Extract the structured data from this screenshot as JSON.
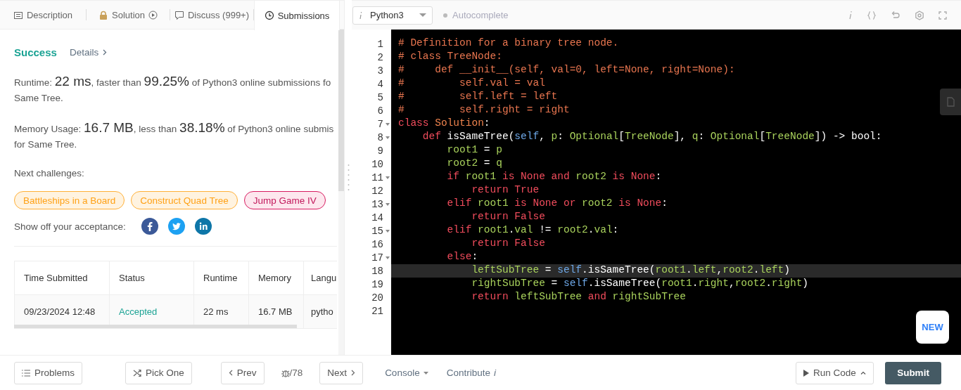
{
  "tabs": [
    {
      "label": "Description",
      "selected": false
    },
    {
      "label": "Solution",
      "selected": false
    },
    {
      "label": "Discuss (999+)",
      "selected": false
    },
    {
      "label": "Submissions",
      "selected": true
    }
  ],
  "result": {
    "status": "Success",
    "details_link": "Details",
    "runtime": {
      "segments": [
        {
          "text": "Runtime: ",
          "kind": "label"
        },
        {
          "text": "22 ms",
          "kind": "value"
        },
        {
          "text": ", faster than ",
          "kind": "label"
        },
        {
          "text": "99.25%",
          "kind": "value"
        },
        {
          "text": " of Python3 online submissions fo",
          "kind": "label"
        }
      ],
      "second_line": "Same Tree."
    },
    "memory": {
      "segments": [
        {
          "text": "Memory Usage: ",
          "kind": "label"
        },
        {
          "text": "16.7 MB",
          "kind": "value"
        },
        {
          "text": ", less than ",
          "kind": "label"
        },
        {
          "text": "38.18%",
          "kind": "value"
        },
        {
          "text": " of Python3 online submis",
          "kind": "label"
        }
      ],
      "second_line": "for Same Tree."
    },
    "next_label": "Next challenges:",
    "challenges": [
      {
        "label": "Battleships in a Board",
        "kind": "medium"
      },
      {
        "label": "Construct Quad Tree",
        "kind": "medium"
      },
      {
        "label": "Jump Game IV",
        "kind": "hard"
      }
    ],
    "share_label": "Show off your acceptance:"
  },
  "table": {
    "columns": [
      "Time Submitted",
      "Status",
      "Runtime",
      "Memory",
      "Langu"
    ],
    "rows": [
      {
        "cells": [
          "09/23/2024 12:48",
          "Accepted",
          "22 ms",
          "16.7 MB",
          "pytho"
        ],
        "kind": "accepted"
      }
    ]
  },
  "editor": {
    "language": "Python3",
    "autocomplete": "Autocomplete",
    "new_badge": "NEW",
    "lines": [
      {
        "number": "1",
        "fold": false,
        "active": false,
        "tokens": [
          {
            "kind": "comment",
            "text": "# Definition for a binary tree node."
          }
        ]
      },
      {
        "number": "2",
        "fold": false,
        "active": false,
        "tokens": [
          {
            "kind": "comment",
            "text": "# class TreeNode:"
          }
        ]
      },
      {
        "number": "3",
        "fold": false,
        "active": false,
        "tokens": [
          {
            "kind": "comment",
            "text": "#     def __init__(self, val=0, left=None, right=None):"
          }
        ]
      },
      {
        "number": "4",
        "fold": false,
        "active": false,
        "tokens": [
          {
            "kind": "comment",
            "text": "#         self.val = val"
          }
        ]
      },
      {
        "number": "5",
        "fold": false,
        "active": false,
        "tokens": [
          {
            "kind": "comment",
            "text": "#         self.left = left"
          }
        ]
      },
      {
        "number": "6",
        "fold": false,
        "active": false,
        "tokens": [
          {
            "kind": "comment",
            "text": "#         self.right = right"
          }
        ]
      },
      {
        "number": "7",
        "fold": true,
        "active": false,
        "tokens": [
          {
            "kind": "keyword",
            "text": "class"
          },
          {
            "kind": "class",
            "text": " Solution"
          },
          {
            "kind": "plain",
            "text": ":"
          }
        ]
      },
      {
        "number": "8",
        "fold": true,
        "active": false,
        "tokens": [
          {
            "kind": "keyword",
            "text": "    def"
          },
          {
            "kind": "plain",
            "text": " isSameTree("
          },
          {
            "kind": "self",
            "text": "self"
          },
          {
            "kind": "plain",
            "text": ","
          },
          {
            "kind": "name",
            "text": " p"
          },
          {
            "kind": "plain",
            "text": ":"
          },
          {
            "kind": "name",
            "text": " Optional"
          },
          {
            "kind": "plain",
            "text": "["
          },
          {
            "kind": "name",
            "text": "TreeNode"
          },
          {
            "kind": "plain",
            "text": "],"
          },
          {
            "kind": "name",
            "text": " q"
          },
          {
            "kind": "plain",
            "text": ":"
          },
          {
            "kind": "name",
            "text": " Optional"
          },
          {
            "kind": "plain",
            "text": "["
          },
          {
            "kind": "name",
            "text": "TreeNode"
          },
          {
            "kind": "plain",
            "text": "]) -> bool:"
          }
        ]
      },
      {
        "number": "9",
        "fold": false,
        "active": false,
        "tokens": [
          {
            "kind": "name",
            "text": "        root1"
          },
          {
            "kind": "plain",
            "text": " ="
          },
          {
            "kind": "name",
            "text": " p"
          }
        ]
      },
      {
        "number": "10",
        "fold": false,
        "active": false,
        "tokens": [
          {
            "kind": "name",
            "text": "        root2"
          },
          {
            "kind": "plain",
            "text": " ="
          },
          {
            "kind": "name",
            "text": " q"
          }
        ]
      },
      {
        "number": "11",
        "fold": true,
        "active": false,
        "tokens": [
          {
            "kind": "keyword",
            "text": "        if"
          },
          {
            "kind": "name",
            "text": " root1"
          },
          {
            "kind": "keyword",
            "text": " is None and"
          },
          {
            "kind": "name",
            "text": " root2"
          },
          {
            "kind": "keyword",
            "text": " is None"
          },
          {
            "kind": "plain",
            "text": ":"
          }
        ]
      },
      {
        "number": "12",
        "fold": false,
        "active": false,
        "tokens": [
          {
            "kind": "keyword",
            "text": "            return True"
          }
        ]
      },
      {
        "number": "13",
        "fold": true,
        "active": false,
        "tokens": [
          {
            "kind": "keyword",
            "text": "        elif"
          },
          {
            "kind": "name",
            "text": " root1"
          },
          {
            "kind": "keyword",
            "text": " is None or"
          },
          {
            "kind": "name",
            "text": " root2"
          },
          {
            "kind": "keyword",
            "text": " is None"
          },
          {
            "kind": "plain",
            "text": ":"
          }
        ]
      },
      {
        "number": "14",
        "fold": false,
        "active": false,
        "tokens": [
          {
            "kind": "keyword",
            "text": "            return False"
          }
        ]
      },
      {
        "number": "15",
        "fold": true,
        "active": false,
        "tokens": [
          {
            "kind": "keyword",
            "text": "        elif"
          },
          {
            "kind": "name",
            "text": " root1"
          },
          {
            "kind": "plain",
            "text": "."
          },
          {
            "kind": "name",
            "text": "val"
          },
          {
            "kind": "plain",
            "text": " !="
          },
          {
            "kind": "name",
            "text": " root2"
          },
          {
            "kind": "plain",
            "text": "."
          },
          {
            "kind": "name",
            "text": "val"
          },
          {
            "kind": "plain",
            "text": ":"
          }
        ]
      },
      {
        "number": "16",
        "fold": false,
        "active": false,
        "tokens": [
          {
            "kind": "keyword",
            "text": "            return False"
          }
        ]
      },
      {
        "number": "17",
        "fold": true,
        "active": false,
        "tokens": [
          {
            "kind": "keyword",
            "text": "        else"
          },
          {
            "kind": "plain",
            "text": ":"
          }
        ]
      },
      {
        "number": "18",
        "fold": false,
        "active": true,
        "tokens": [
          {
            "kind": "name",
            "text": "            leftSubTree"
          },
          {
            "kind": "plain",
            "text": " ="
          },
          {
            "kind": "self",
            "text": " self"
          },
          {
            "kind": "plain",
            "text": ".isSameTree("
          },
          {
            "kind": "name",
            "text": "root1"
          },
          {
            "kind": "plain",
            "text": "."
          },
          {
            "kind": "name",
            "text": "left"
          },
          {
            "kind": "plain",
            "text": ","
          },
          {
            "kind": "name",
            "text": "root2"
          },
          {
            "kind": "plain",
            "text": "."
          },
          {
            "kind": "name",
            "text": "left"
          },
          {
            "kind": "plain",
            "text": ")"
          }
        ]
      },
      {
        "number": "19",
        "fold": false,
        "active": false,
        "tokens": [
          {
            "kind": "name",
            "text": "            rightSubTree"
          },
          {
            "kind": "plain",
            "text": " ="
          },
          {
            "kind": "self",
            "text": " self"
          },
          {
            "kind": "plain",
            "text": ".isSameTree("
          },
          {
            "kind": "name",
            "text": "root1"
          },
          {
            "kind": "plain",
            "text": "."
          },
          {
            "kind": "name",
            "text": "right"
          },
          {
            "kind": "plain",
            "text": ","
          },
          {
            "kind": "name",
            "text": "root2"
          },
          {
            "kind": "plain",
            "text": "."
          },
          {
            "kind": "name",
            "text": "right"
          },
          {
            "kind": "plain",
            "text": ")"
          }
        ]
      },
      {
        "number": "20",
        "fold": false,
        "active": false,
        "tokens": [
          {
            "kind": "keyword",
            "text": "            return"
          },
          {
            "kind": "name",
            "text": " leftSubTree"
          },
          {
            "kind": "keyword",
            "text": " and"
          },
          {
            "kind": "name",
            "text": " rightSubTree"
          }
        ]
      },
      {
        "number": "21",
        "fold": false,
        "active": false
      }
    ]
  },
  "footer": {
    "problems": "Problems",
    "pick_one": "Pick One",
    "prev": "Prev",
    "counter": "/78",
    "next": "Next",
    "console": "Console",
    "contribute": "Contribute",
    "contribute_info": "i",
    "run_code": "Run Code",
    "submit": "Submit"
  }
}
